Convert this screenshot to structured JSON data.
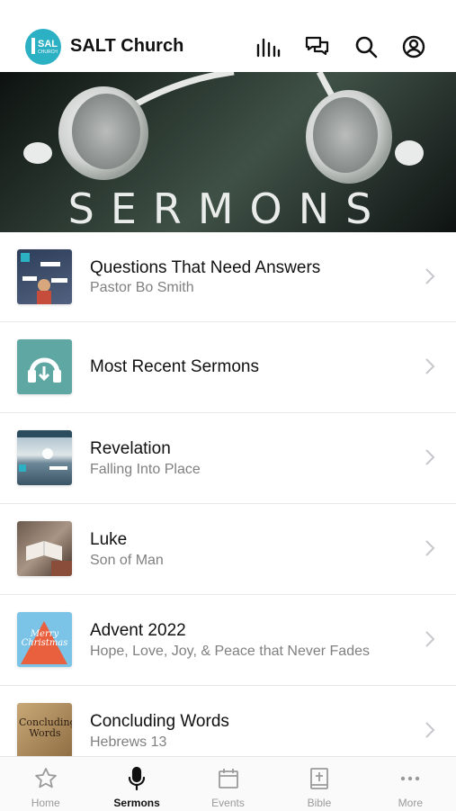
{
  "header": {
    "app_title": "SALT Church",
    "logo_text": "SAL",
    "logo_sub": "CHURCH"
  },
  "hero": {
    "title": "SERMONS"
  },
  "sermons": [
    {
      "title": "Questions That Need Answers",
      "subtitle": "Pastor Bo Smith"
    },
    {
      "title": "Most Recent Sermons",
      "subtitle": ""
    },
    {
      "title": "Revelation",
      "subtitle": "Falling Into Place"
    },
    {
      "title": "Luke",
      "subtitle": "Son of Man"
    },
    {
      "title": "Advent 2022",
      "subtitle": "Hope, Love, Joy, & Peace that Never Fades"
    },
    {
      "title": "Concluding Words",
      "subtitle": "Hebrews 13"
    }
  ],
  "thumb_text": {
    "advent": "Merry Christmas",
    "concluding": "Concluding Words"
  },
  "tabs": [
    {
      "label": "Home",
      "icon": "star-icon"
    },
    {
      "label": "Sermons",
      "icon": "microphone-icon"
    },
    {
      "label": "Events",
      "icon": "calendar-icon"
    },
    {
      "label": "Bible",
      "icon": "bible-icon"
    },
    {
      "label": "More",
      "icon": "more-icon"
    }
  ],
  "colors": {
    "brand": "#2bb0c4",
    "active_tab": "#111111",
    "inactive_tab": "#9a9a9a"
  }
}
